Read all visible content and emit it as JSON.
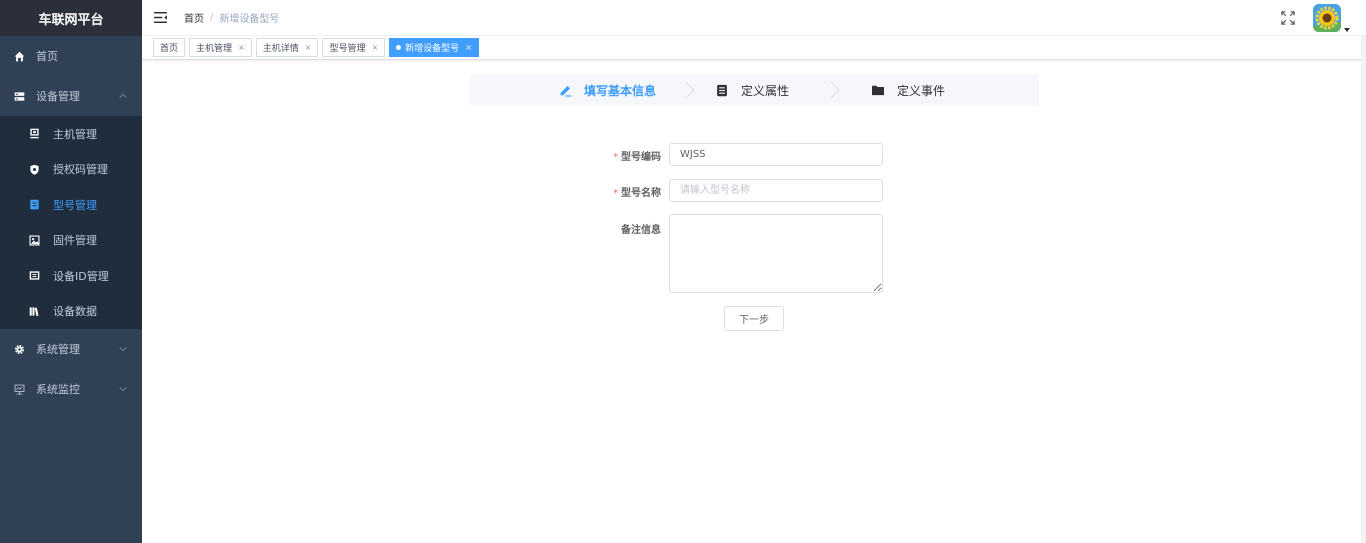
{
  "app": {
    "title": "车联网平台"
  },
  "sidebar": {
    "items": [
      {
        "label": "首页",
        "icon": "home-icon"
      },
      {
        "label": "设备管理",
        "icon": "server-icon",
        "expanded": true,
        "children": [
          {
            "label": "主机管理",
            "icon": "monitor-icon"
          },
          {
            "label": "授权码管理",
            "icon": "shield-icon"
          },
          {
            "label": "型号管理",
            "icon": "list-icon",
            "active": true
          },
          {
            "label": "固件管理",
            "icon": "image-icon"
          },
          {
            "label": "设备ID管理",
            "icon": "id-card-icon"
          },
          {
            "label": "设备数据",
            "icon": "books-icon"
          }
        ]
      },
      {
        "label": "系统管理",
        "icon": "gear-icon"
      },
      {
        "label": "系统监控",
        "icon": "monitor-chart-icon"
      }
    ]
  },
  "navbar": {
    "breadcrumb_home": "首页",
    "breadcrumb_sep": "/",
    "breadcrumb_current": "新增设备型号"
  },
  "tags": [
    {
      "label": "首页",
      "closable": false
    },
    {
      "label": "主机管理",
      "closable": true
    },
    {
      "label": "主机详情",
      "closable": true
    },
    {
      "label": "型号管理",
      "closable": true
    },
    {
      "label": "新增设备型号",
      "closable": true,
      "active": true
    }
  ],
  "tag_close_symbol": "×",
  "steps": [
    {
      "label": "填写基本信息",
      "icon": "edit-icon",
      "active": true
    },
    {
      "label": "定义属性",
      "icon": "document-icon",
      "active": false
    },
    {
      "label": "定义事件",
      "icon": "folder-icon",
      "active": false
    }
  ],
  "form": {
    "required_mark": "*",
    "model_code_label": "型号编码",
    "model_code_value": "WJSS",
    "model_name_label": "型号名称",
    "model_name_placeholder": "请输入型号名称",
    "remark_label": "备注信息",
    "remark_value": "",
    "next_button": "下一步"
  },
  "colors": {
    "sidebar_bg": "#304156",
    "submenu_bg": "#1f2d3d",
    "accent": "#409eff",
    "required": "#f56c6c"
  }
}
